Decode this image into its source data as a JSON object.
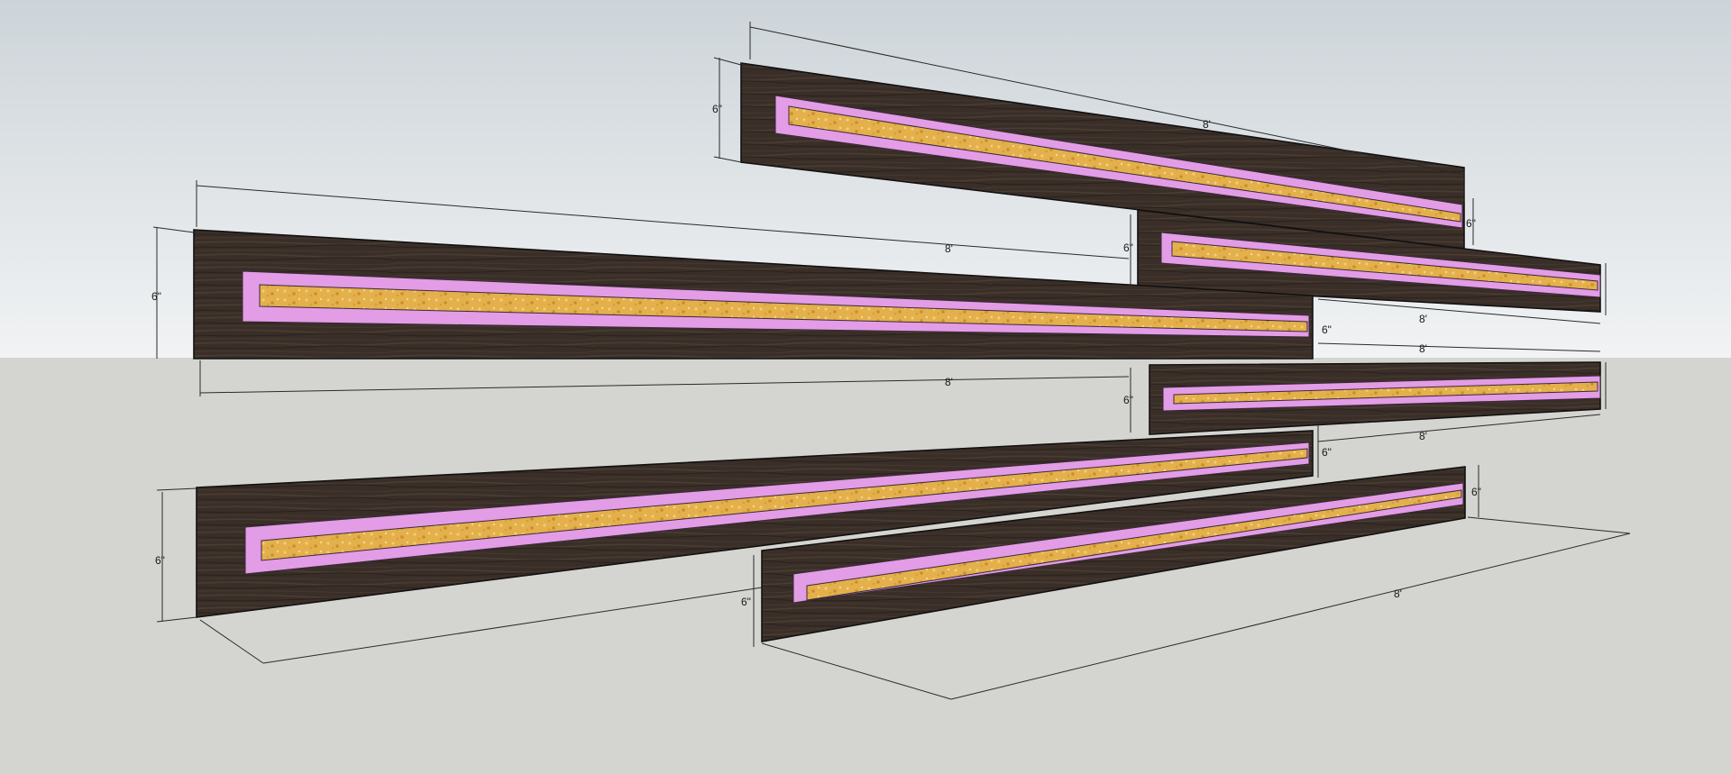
{
  "scene": {
    "sky_color": "#dfe3e6",
    "ground_color": "#d4d5d0",
    "wood_color": "#3b3029",
    "inlay_color": "#e39ce6",
    "resin_color": "#e6b24a"
  },
  "boards": [
    {
      "name": "board-top-right",
      "length_label": "8'",
      "height_label": "6\""
    },
    {
      "name": "board-mid-right-upper",
      "length_label": "8'",
      "height_label": "6\""
    },
    {
      "name": "board-left-upper",
      "length_label": "8'",
      "height_label": "6\""
    },
    {
      "name": "board-mid-right-lower",
      "length_label": "8'",
      "height_label": "6\""
    },
    {
      "name": "board-left-lower",
      "length_label": "8'",
      "height_label": "6\""
    },
    {
      "name": "board-bottom-right",
      "length_label": "8'",
      "height_label": "6\""
    }
  ],
  "dimensions": {
    "len1": "8'",
    "len2": "8'",
    "len3": "8'",
    "len4": "8'",
    "len5": "8'",
    "len6": "8'",
    "len7": "8'",
    "h1": "6\"",
    "h2": "6\"",
    "h3": "6\"",
    "h4": "6\"",
    "h5": "6\"",
    "h6": "6\"",
    "h7": "6\"",
    "h8": "6\"",
    "h9": "6\"",
    "h10": "6\""
  }
}
